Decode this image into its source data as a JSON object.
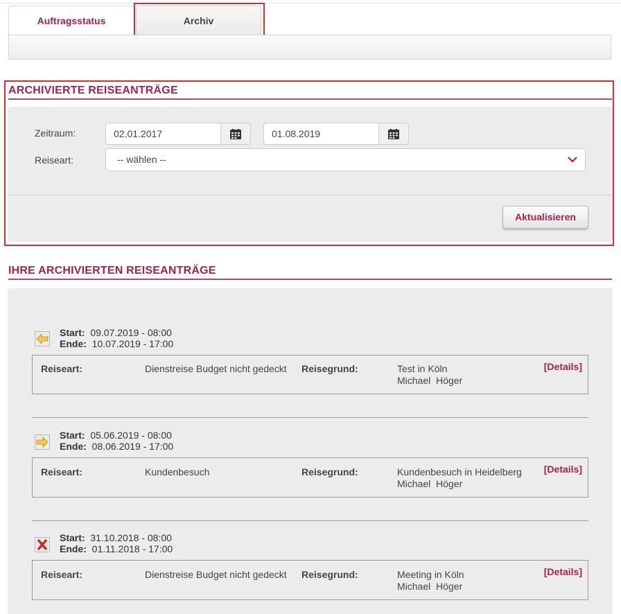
{
  "tabs": [
    {
      "label": "Auftragsstatus"
    },
    {
      "label": "Archiv"
    }
  ],
  "filter": {
    "heading": "ARCHIVIERTE REISEANTRÄGE",
    "zeitraum_label": "Zeitraum:",
    "date_from": "02.01.2017",
    "date_to": "01.08.2019",
    "reiseart_label": "Reiseart:",
    "reiseart_value": "-- wählen --",
    "update_button": "Aktualisieren"
  },
  "results": {
    "heading": "IHRE ARCHIVIERTEN REISEANTRÄGE",
    "labels": {
      "start": "Start:",
      "end": "Ende:",
      "reiseart": "Reiseart:",
      "reisegrund": "Reisegrund:",
      "details": "[Details]"
    },
    "items": [
      {
        "status_icon": "arrow-left-icon",
        "start": "09.07.2019 - 08:00",
        "end": "10.07.2019 - 17:00",
        "reiseart": "Dienstreise Budget nicht gedeckt",
        "reisegrund": "Test in Köln",
        "person": "Michael  Höger"
      },
      {
        "status_icon": "arrow-right-icon",
        "start": "05.06.2019 - 08:00",
        "end": "08.06.2019 - 17:00",
        "reiseart": "Kundenbesuch",
        "reisegrund": "Kundenbesuch in Heidelberg",
        "person": "Michael  Höger"
      },
      {
        "status_icon": "rejected-x-icon",
        "start": "31.10.2018 - 08:00",
        "end": "01.11.2018 - 17:00",
        "reiseart": "Dienstreise Budget nicht gedeckt",
        "reisegrund": "Meeting in Köln",
        "person": "Michael  Höger"
      }
    ]
  },
  "colors": {
    "accent": "#a5214f",
    "highlight": "#dc2b35",
    "panel": "#ececec"
  }
}
